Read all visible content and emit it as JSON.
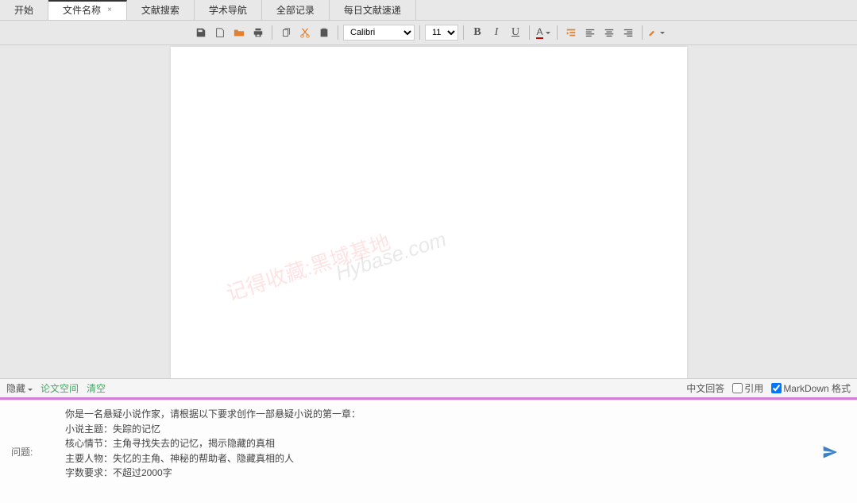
{
  "tabs": [
    {
      "label": "开始"
    },
    {
      "label": "文件名称",
      "active": true,
      "closable": true
    },
    {
      "label": "文献搜索"
    },
    {
      "label": "学术导航"
    },
    {
      "label": "全部记录"
    },
    {
      "label": "每日文献速递"
    }
  ],
  "toolbar": {
    "font": "Calibri",
    "size": "11",
    "bold": "B",
    "italic": "I",
    "underline": "U",
    "fontcolor": "A"
  },
  "watermark1": "记得收藏:黑域基地",
  "watermark2": "Hybase.com",
  "bottom": {
    "hide": "隐藏",
    "paperSpace": "论文空间",
    "clear": "清空",
    "cnAnswer": "中文回答",
    "cite": "引用",
    "markdown": "MarkDown 格式"
  },
  "chat": {
    "label": "问题:",
    "content": "你是一名悬疑小说作家，请根据以下要求创作一部悬疑小说的第一章：\n小说主题：失踪的记忆\n核心情节：主角寻找失去的记忆，揭示隐藏的真相\n主要人物：失忆的主角、神秘的帮助者、隐藏真相的人\n字数要求：不超过2000字"
  }
}
